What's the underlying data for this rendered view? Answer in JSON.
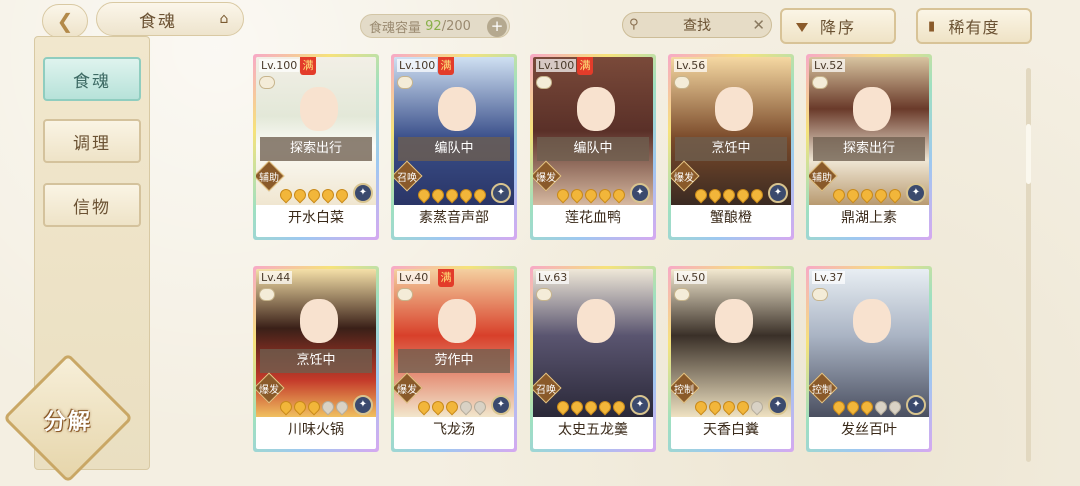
{
  "header": {
    "title": "食魂",
    "capacity_label": "食魂容量",
    "capacity_current": "92",
    "capacity_total": "/200",
    "search_label": "查找",
    "sort_label": "降序",
    "rarity_label": "稀有度"
  },
  "sidebar": {
    "tabs": [
      {
        "label": "食魂"
      },
      {
        "label": "调理"
      },
      {
        "label": "信物"
      }
    ],
    "decompose_label": "分解"
  },
  "cards": [
    {
      "level": "Lv.100",
      "full": "满",
      "status": "探索出行",
      "role": "辅助",
      "stars": 5,
      "name": "开水白菜"
    },
    {
      "level": "Lv.100",
      "full": "满",
      "status": "编队中",
      "role": "召唤",
      "stars": 5,
      "name": "素蒸音声部"
    },
    {
      "level": "Lv.100",
      "full": "满",
      "status": "编队中",
      "role": "爆发",
      "stars": 5,
      "name": "莲花血鸭"
    },
    {
      "level": "Lv.56",
      "full": "",
      "status": "烹饪中",
      "role": "爆发",
      "stars": 5,
      "name": "蟹酿橙"
    },
    {
      "level": "Lv.52",
      "full": "",
      "status": "探索出行",
      "role": "辅助",
      "stars": 5,
      "name": "鼎湖上素"
    },
    {
      "level": "Lv.44",
      "full": "",
      "status": "烹饪中",
      "role": "爆发",
      "stars": 3,
      "name": "川味火锅"
    },
    {
      "level": "Lv.40",
      "full": "满",
      "status": "劳作中",
      "role": "爆发",
      "stars": 3,
      "name": "飞龙汤"
    },
    {
      "level": "Lv.63",
      "full": "",
      "status": "",
      "role": "召唤",
      "stars": 5,
      "name": "太史五龙羹"
    },
    {
      "level": "Lv.50",
      "full": "",
      "status": "",
      "role": "控制",
      "stars": 4,
      "name": "天香白糞"
    },
    {
      "level": "Lv.37",
      "full": "",
      "status": "",
      "role": "控制",
      "stars": 3,
      "name": "发丝百叶"
    }
  ]
}
